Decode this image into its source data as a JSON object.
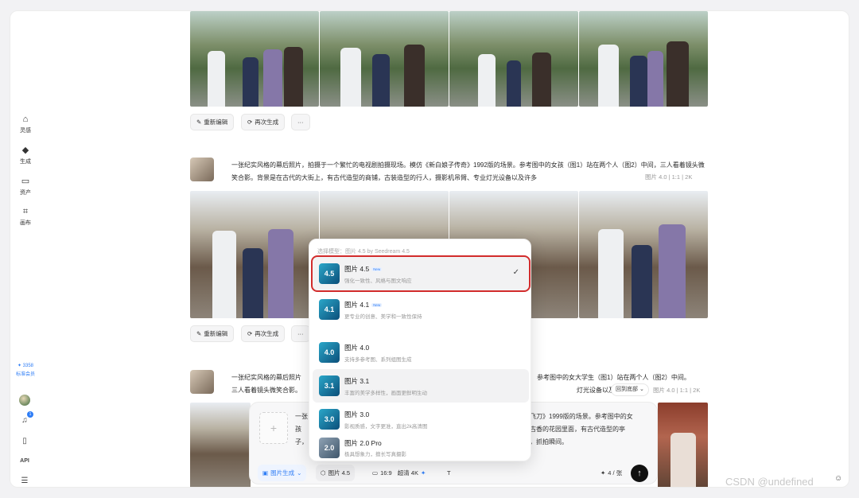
{
  "sidebar": {
    "items": [
      {
        "label": "灵感",
        "icon": "home-icon"
      },
      {
        "label": "生成",
        "icon": "diamond-icon"
      },
      {
        "label": "资产",
        "icon": "folder-icon"
      },
      {
        "label": "画布",
        "icon": "canvas-icon"
      }
    ],
    "credits": "3358",
    "membership": "标准会员",
    "notification_count": "1",
    "api_label": "API"
  },
  "feed": {
    "edit_label": "重新编辑",
    "regen_label": "再次生成",
    "more_label": "···",
    "post2": {
      "prompt": "一张纪实风格的幕后照片，拍摄于一个繁忙的电视剧拍摄现场。模仿《新白娘子传奇》1992版的场景。参考图中的女孩（图1）站在两个人（图2）中间，三人看着镜头微笑合影。背景是在古代的大街上，有古代造型的商铺，古装造型的行人，摄影机吊臂、专业灯光设备以及许多",
      "meta": "图片 4.0  |  1:1  |  2K"
    },
    "post3": {
      "prompt_left": "一张纪实风格的幕后照片",
      "prompt_mid": "参考图中的女大学生（图1）站在两个人（图2）中间。",
      "prompt_left2": "三人看着镜头微笑合影。",
      "prompt_mid2": "灯光设备以及许多化妆",
      "meta": "图片 4.0  |  1:1  |  2K",
      "back_to_bottom": "回到底部"
    }
  },
  "model_dropdown": {
    "header": "选择模型：图片 4.5 by Seedream 4.5",
    "options": [
      {
        "logo": "4.5",
        "title": "图片 4.5",
        "tag": "New",
        "subtitle": "强化一致性、风格与图文响应",
        "selected": true
      },
      {
        "logo": "4.1",
        "title": "图片 4.1",
        "tag": "New",
        "subtitle": "更专业的创意、美学和一致性保持",
        "selected": false
      },
      {
        "logo": "4.0",
        "title": "图片 4.0",
        "tag": "",
        "subtitle": "支持多参考图、系列组图生成",
        "selected": false
      },
      {
        "logo": "3.1",
        "title": "图片 3.1",
        "tag": "",
        "subtitle": "丰富的美学多样性，画面更鲜明生动",
        "selected": false
      },
      {
        "logo": "3.0",
        "title": "图片 3.0",
        "tag": "",
        "subtitle": "影视质感，文字更准，直出2k高清图",
        "selected": false
      },
      {
        "logo": "2.0",
        "title": "图片 2.0 Pro",
        "tag": "",
        "subtitle": "极具想象力，擅长写真摄影",
        "selected": false
      }
    ]
  },
  "input": {
    "text_left1": "一张",
    "text_left2": "孩",
    "text_left3": "子，",
    "text_right1": "飞刀》1999版的场景。参考图中的女",
    "text_right2": "古香的花园里面，有古代造型的亭",
    "text_right3": "，抓拍瞬间。",
    "mode_label": "图片生成",
    "model_label": "图片 4.5",
    "ratio_label": "16:9",
    "quality_label": "超清 4K",
    "count_label": "4 / 张"
  },
  "colors": {
    "accent": "#2e7df6",
    "highlight": "#d22c2c"
  },
  "watermark": "CSDN @undefined"
}
